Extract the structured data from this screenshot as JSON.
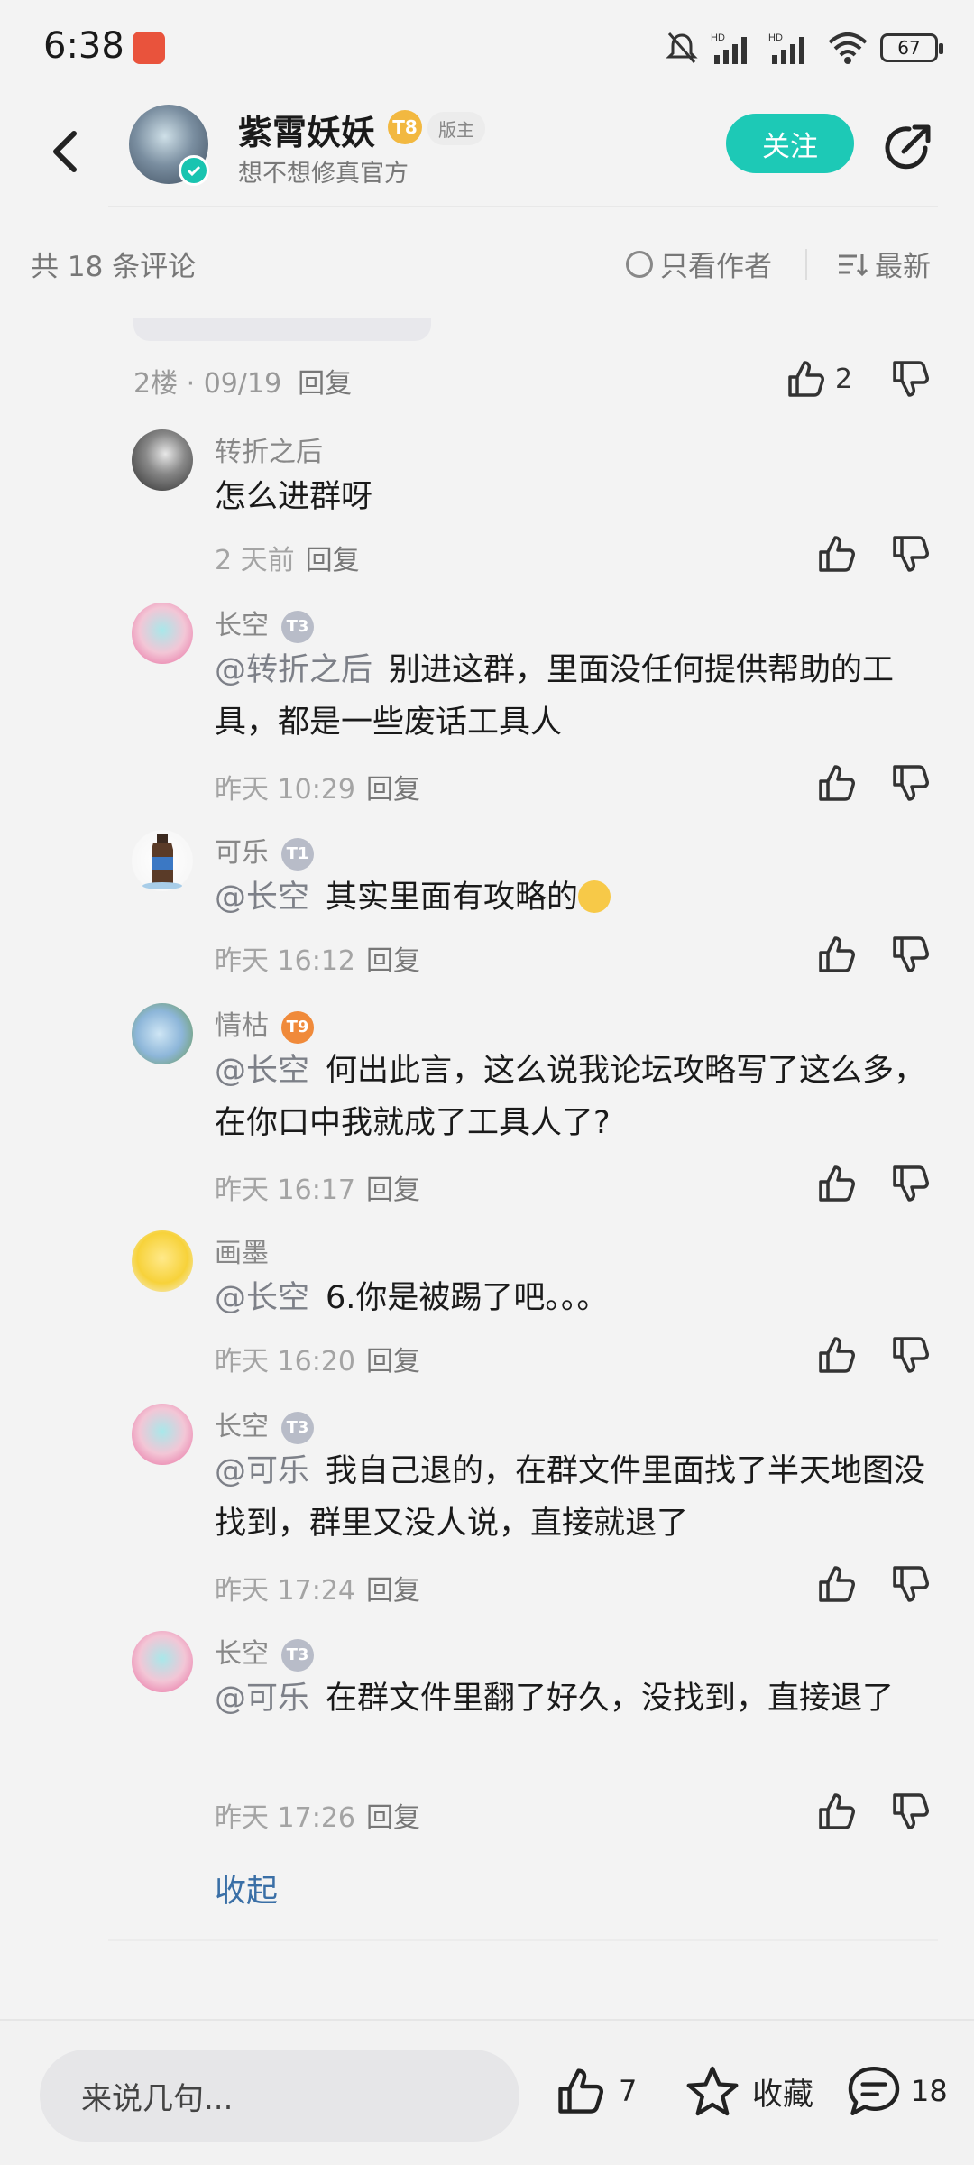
{
  "status_bar": {
    "time": "6:38",
    "battery": "67",
    "icons": [
      "app-notification-icon",
      "mute-bell-icon",
      "hd-signal-icon",
      "hd-signal-icon",
      "wifi-icon",
      "battery-icon"
    ]
  },
  "header": {
    "name": "紫霄妖妖",
    "level_badge": "T8",
    "role_badge": "版主",
    "subtitle": "想不想修真官方",
    "follow_label": "关注"
  },
  "filter": {
    "count_text": "共 18 条评论",
    "author_only_label": "只看作者",
    "sort_label": "最新"
  },
  "floor": {
    "meta": "2楼 · 09/19",
    "reply_label": "回复",
    "like_count": "2"
  },
  "comments": [
    {
      "name": "转折之后",
      "badge": "",
      "mention": "",
      "text": "怎么进群呀",
      "time": "2 天前",
      "reply": "回复"
    },
    {
      "name": "长空",
      "badge": "T3",
      "mention": "@转折之后",
      "text": "别进这群，里面没任何提供帮助的工具，都是一些废话工具人",
      "time": "昨天 10:29",
      "reply": "回复"
    },
    {
      "name": "可乐",
      "badge": "T1",
      "mention": "@长空",
      "text": "其实里面有攻略的",
      "time": "昨天 16:12",
      "reply": "回复"
    },
    {
      "name": "情枯",
      "badge": "T9",
      "mention": "@长空",
      "text": "何出此言，这么说我论坛攻略写了这么多，在你口中我就成了工具人了?",
      "time": "昨天 16:17",
      "reply": "回复"
    },
    {
      "name": "画墨",
      "badge": "",
      "mention": "@长空",
      "text": "6.你是被踢了吧。。。",
      "time": "昨天 16:20",
      "reply": "回复"
    },
    {
      "name": "长空",
      "badge": "T3",
      "mention": "@可乐",
      "text": "我自己退的，在群文件里面找了半天地图没找到，群里又没人说，直接就退了",
      "time": "昨天 17:24",
      "reply": "回复"
    },
    {
      "name": "长空",
      "badge": "T3",
      "mention": "@可乐",
      "text": "在群文件里翻了好久，没找到，直接退了",
      "time": "昨天 17:26",
      "reply": "回复"
    }
  ],
  "collapse_label": "收起",
  "bottom_bar": {
    "input_placeholder": "来说几句...",
    "like_count": "7",
    "favorite_label": "收藏",
    "comment_count": "18"
  },
  "colors": {
    "accent": "#1dc9b6",
    "link": "#3a6fa6",
    "background": "#f3f3f3"
  }
}
